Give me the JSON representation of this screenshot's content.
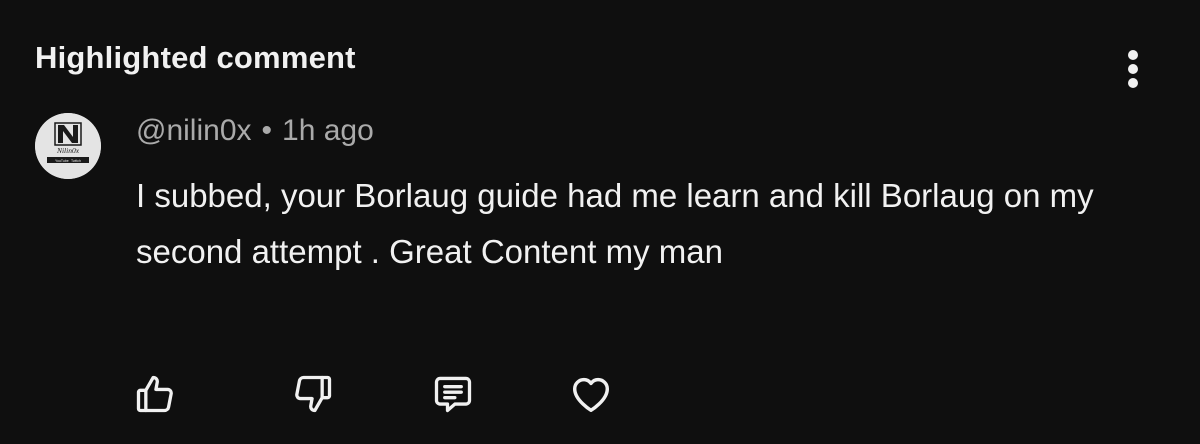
{
  "header": {
    "title": "Highlighted comment",
    "more_icon": "more-vertical-icon"
  },
  "comment": {
    "author": "@nilin0x",
    "separator": "•",
    "time": "1h ago",
    "text": "I subbed, your Borlaug guide had me learn and kill Borlaug on my second attempt . Great Content my man",
    "avatar": {
      "logo_text": "Nilin0x",
      "logo_subtext_left": "YouTube",
      "logo_subtext_right": "Twitch"
    }
  },
  "actions": {
    "like_icon": "thumbs-up-icon",
    "dislike_icon": "thumbs-down-icon",
    "reply_icon": "reply-comment-icon",
    "heart_icon": "heart-icon"
  },
  "colors": {
    "background": "#0f0f0f",
    "text_primary": "#f1f1f1",
    "text_secondary": "#aaaaaa"
  }
}
